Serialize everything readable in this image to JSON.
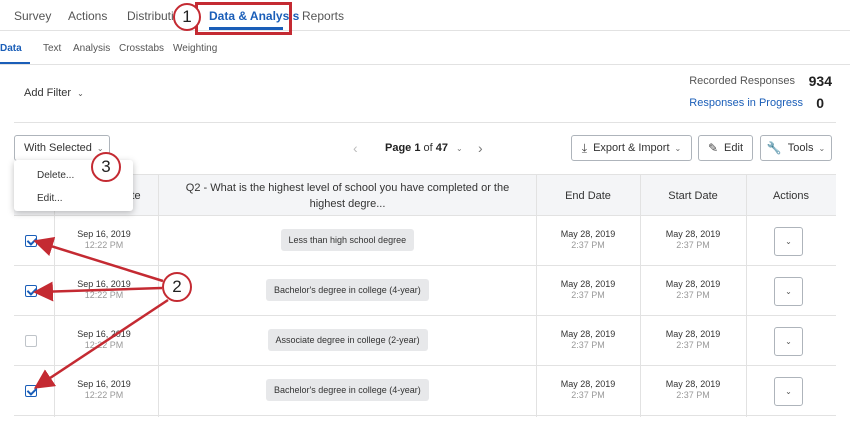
{
  "topnav": {
    "tabs": [
      "Survey",
      "Actions",
      "Distributio",
      "Data & Analysis",
      "Reports"
    ]
  },
  "subnav": {
    "tabs": [
      "Data",
      "Text",
      "Analysis",
      "Crosstabs",
      "Weighting"
    ]
  },
  "filter": {
    "add_filter": "Add Filter"
  },
  "stats": {
    "recorded_label": "Recorded Responses",
    "recorded_value": "934",
    "progress_label": "Responses in Progress",
    "progress_value": "0"
  },
  "toolbar": {
    "with_selected": "With Selected",
    "page_prefix": "Page",
    "page_num": "1",
    "page_of": "of",
    "page_total": "47",
    "export": "Export & Import",
    "edit": "Edit",
    "tools": "Tools"
  },
  "dropdown": {
    "items": [
      "Delete...",
      "Edit..."
    ]
  },
  "table": {
    "headers": {
      "date_partial": "te",
      "q2": "Q2 - What is the highest level of school you have completed or the highest degre...",
      "end": "End Date",
      "start": "Start Date",
      "actions": "Actions"
    },
    "rows": [
      {
        "checked": true,
        "rec_date": "Sep 16, 2019",
        "rec_time": "12:22 PM",
        "answer": "Less than high school degree",
        "end_date": "May 28, 2019",
        "end_time": "2:37 PM",
        "start_date": "May 28, 2019",
        "start_time": "2:37 PM"
      },
      {
        "checked": true,
        "rec_date": "Sep 16, 2019",
        "rec_time": "12:22 PM",
        "answer": "Bachelor's degree in college (4-year)",
        "end_date": "May 28, 2019",
        "end_time": "2:37 PM",
        "start_date": "May 28, 2019",
        "start_time": "2:37 PM"
      },
      {
        "checked": false,
        "rec_date": "Sep 16, 2019",
        "rec_time": "12:22 PM",
        "answer": "Associate degree in college (2-year)",
        "end_date": "May 28, 2019",
        "end_time": "2:37 PM",
        "start_date": "May 28, 2019",
        "start_time": "2:37 PM"
      },
      {
        "checked": true,
        "rec_date": "Sep 16, 2019",
        "rec_time": "12:22 PM",
        "answer": "Bachelor's degree in college (4-year)",
        "end_date": "May 28, 2019",
        "end_time": "2:37 PM",
        "start_date": "May 28, 2019",
        "start_time": "2:37 PM"
      }
    ]
  },
  "callouts": [
    "1",
    "2",
    "3"
  ],
  "colors": {
    "accent": "#1a5eb8",
    "callout": "#c42a32"
  }
}
